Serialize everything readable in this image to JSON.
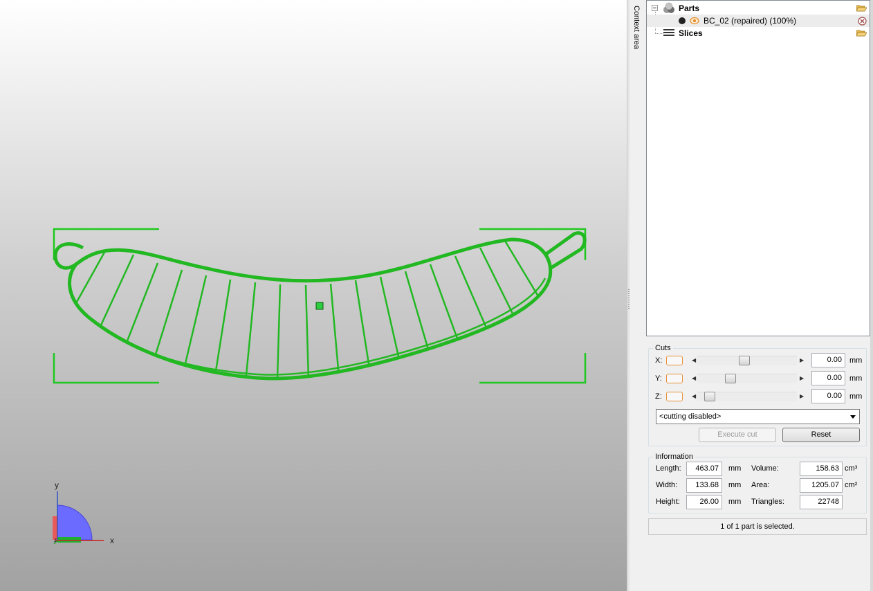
{
  "viewport": {
    "axis_x_label": "x",
    "axis_y_label": "y",
    "axis_z_label": "z",
    "colors": {
      "model": "#22b822",
      "selection_bracket": "#1ec81e",
      "axis_x": "#e02020",
      "axis_y": "#2050e0",
      "axis_z": "#20a020"
    }
  },
  "context_strip": {
    "label": "Context area"
  },
  "tree": {
    "parts_label": "Parts",
    "part_item_label": "BC_02 (repaired) (100%)",
    "slices_label": "Slices"
  },
  "cuts": {
    "title": "Cuts",
    "x_label": "X:",
    "y_label": "Y:",
    "z_label": "Z:",
    "x_value": "0.00",
    "y_value": "0.00",
    "z_value": "0.00",
    "unit": "mm",
    "mode_selected": "<cutting disabled>",
    "execute_label": "Execute cut",
    "reset_label": "Reset"
  },
  "information": {
    "title": "Information",
    "length_label": "Length:",
    "length_value": "463.07",
    "width_label": "Width:",
    "width_value": "133.68",
    "height_label": "Height:",
    "height_value": "26.00",
    "mm_unit": "mm",
    "volume_label": "Volume:",
    "volume_value": "158.63",
    "volume_unit": "cm³",
    "area_label": "Area:",
    "area_value": "1205.07",
    "area_unit": "cm²",
    "triangles_label": "Triangles:",
    "triangles_value": "22748"
  },
  "status": {
    "text": "1 of 1 part is selected."
  }
}
